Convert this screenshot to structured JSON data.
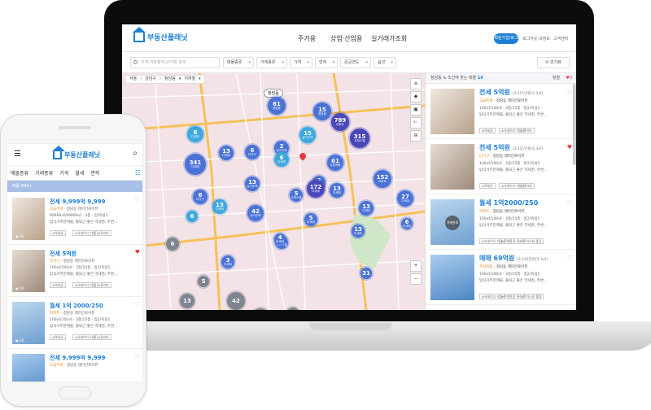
{
  "brand": {
    "name": "부동산플래닛",
    "accent": "#1d7fd4",
    "heart_on": "#e63946"
  },
  "desktop": {
    "nav": [
      "주거용",
      "상업·산업용",
      "실거래가조회"
    ],
    "signup": "회원가입/로그인",
    "mini_links": [
      "로그아웃",
      "내정보",
      "고객센터"
    ],
    "search_placeholder": "지역,지하철역,단지명 검색",
    "filters": [
      "매물종류",
      "거래종류",
      "가격",
      "면적",
      "준공연도",
      "옵션"
    ],
    "reset": "초기화",
    "breadcrumb": [
      "서울",
      "강남구",
      "청담동",
      "지하철"
    ],
    "map_label": "청담동",
    "clusters": [
      {
        "n": "61",
        "s": "청담동"
      },
      {
        "n": "15",
        "s": "청담동"
      },
      {
        "n": "789",
        "s": "아파트"
      },
      {
        "n": "6",
        "s": "다세대"
      },
      {
        "n": "15",
        "s": "상가주택"
      },
      {
        "n": "315",
        "s": "오피스텔"
      },
      {
        "n": "6",
        "s": "다가구"
      },
      {
        "n": "13",
        "s": "다세대"
      },
      {
        "n": "2",
        "s": "상가주택"
      },
      {
        "n": "6",
        "s": "다세대"
      },
      {
        "n": "341",
        "s": "다세대"
      },
      {
        "n": "61",
        "s": "주상복합"
      },
      {
        "n": "13",
        "s": "상가주택"
      },
      {
        "n": "2",
        "s": "다세대"
      },
      {
        "n": "6",
        "s": "다가구"
      },
      {
        "n": "5",
        "s": "오피스텔"
      },
      {
        "n": "172",
        "s": "다세대"
      },
      {
        "n": "13",
        "s": "다세대"
      },
      {
        "n": "152",
        "s": "아파트"
      },
      {
        "n": "13",
        "s": "다세대"
      },
      {
        "n": "27",
        "s": "다세대"
      },
      {
        "n": "6",
        "s": "다세대"
      },
      {
        "n": "42",
        "s": "상가주택"
      },
      {
        "n": "13",
        "s": "다세대"
      },
      {
        "n": "2",
        "s": "오피스텔"
      },
      {
        "n": "5",
        "s": "다세대"
      },
      {
        "n": "13",
        "s": "다세대"
      },
      {
        "n": "4",
        "s": "다세대"
      },
      {
        "n": "6",
        "s": ""
      },
      {
        "n": "6",
        "s": ""
      },
      {
        "n": "3",
        "s": "다세대"
      },
      {
        "n": "42",
        "s": ""
      },
      {
        "n": "127",
        "s": "아파트"
      },
      {
        "n": "5",
        "s": ""
      },
      {
        "n": "5",
        "s": ""
      },
      {
        "n": "13",
        "s": ""
      },
      {
        "n": "31",
        "s": ""
      }
    ],
    "panel_header": "청담동 & 조건에 맞는 매물",
    "panel_count": "16",
    "panel_sort": "정렬",
    "listings": [
      {
        "title": "전세 5억원",
        "area": "(3.211만원/3.3㎡)",
        "type": "고급주택",
        "addr": "청담동 래미안로이뷰",
        "spec": "100㎡/100㎡ · 3층/15층 · 방2/욕실1",
        "desc": "탑식거주한매물, 출퇴근 좋은 역세권, 주변...",
        "tags": [
          "#역세권",
          "#사세이다 저렴",
          "#관리비"
        ],
        "fav": false
      },
      {
        "title": "전세 5억원",
        "area": "(3.211만원/3.3㎡)",
        "type": "다가구",
        "addr": "청담동 래미안로이뷰",
        "spec": "100㎡/100㎡ · 3층/15층 · 방2/욕실1",
        "desc": "탑식거주한매물, 출퇴근 좋은 역세권, 주변...",
        "tags": [
          "#역세권",
          "#사세이다 저렴",
          "#관리비"
        ],
        "fav": true
      },
      {
        "title": "월세 1억2000/250",
        "area": "",
        "type": "아파트",
        "addr": "청담동 래미안로이뷰",
        "spec": "100㎡/100㎡ · 3층/15층 · 방2/욕실1",
        "desc": "탑식거주한매물, 출퇴근 좋은 역세권, 주변...",
        "tags": [
          "#사세이다 저렴",
          "#주변환경 우수",
          "#주차시설 좋음"
        ],
        "fav": false,
        "note": "거래완료"
      },
      {
        "title": "매매 69억원",
        "area": "(3.211만원/3.3㎡)",
        "type": "주상복합",
        "addr": "청담동 래미안로이뷰",
        "spec": "100㎡/100㎡ · 3층/15층 · 방2/욕실1",
        "desc": "탑식거주한매물, 출퇴근 좋은 역세권, 주변...",
        "tags": [
          "#사세이다 저렴",
          "#주변환경 우수",
          "#주차시설 좋음"
        ],
        "fav": false
      },
      {
        "title": "전세 5억원",
        "area": "",
        "type": "",
        "addr": "",
        "spec": "",
        "desc": "",
        "tags": [],
        "fav": false
      }
    ]
  },
  "mobile": {
    "filters": [
      "매물종류",
      "거래종류",
      "가격",
      "월세",
      "면적"
    ],
    "count": "매물 999+",
    "listings": [
      {
        "title": "전세 9,999억 9,999",
        "type": "고급주택",
        "addr": "청담동 래미안로이뷰",
        "spec": "99999㎡/99999㎡ · 3층 · 입/욕실1",
        "desc": "탑식거주한매물, 출퇴근 좋은 역세권, 주변...",
        "tags": [
          "#역세권",
          "#사세이다 저렴",
          "#관리비"
        ],
        "photos": "10",
        "fav": false
      },
      {
        "title": "전세 5억원",
        "type": "다가구",
        "addr": "청담동 래미안로이뷰",
        "spec": "100㎡/100㎡ · 3층/15층 · 방2/욕실1",
        "desc": "탑식거주한매물, 출퇴근 좋은 역세권, 주변...",
        "tags": [
          "#역세권",
          "#사세이다 저렴",
          "#관리비"
        ],
        "photos": "10",
        "fav": true
      },
      {
        "title": "월세 1억 2000/250",
        "type": "아파트",
        "addr": "청담동 래미안로이뷰",
        "spec": "100㎡/100㎡ · 3층/15층 · 방2/욕실1",
        "desc": "탑식거주한매물, 출퇴근 좋은 역세권, 주변...",
        "tags": [
          "#역세권",
          "#사세이다 저렴",
          "#관리비"
        ],
        "photos": "10",
        "fav": false
      },
      {
        "title": "전세 9,999억 9,999",
        "type": "고급주택",
        "addr": "청담동 래미안로이뷰",
        "spec": "",
        "desc": "",
        "tags": [],
        "photos": "",
        "fav": false
      }
    ]
  }
}
